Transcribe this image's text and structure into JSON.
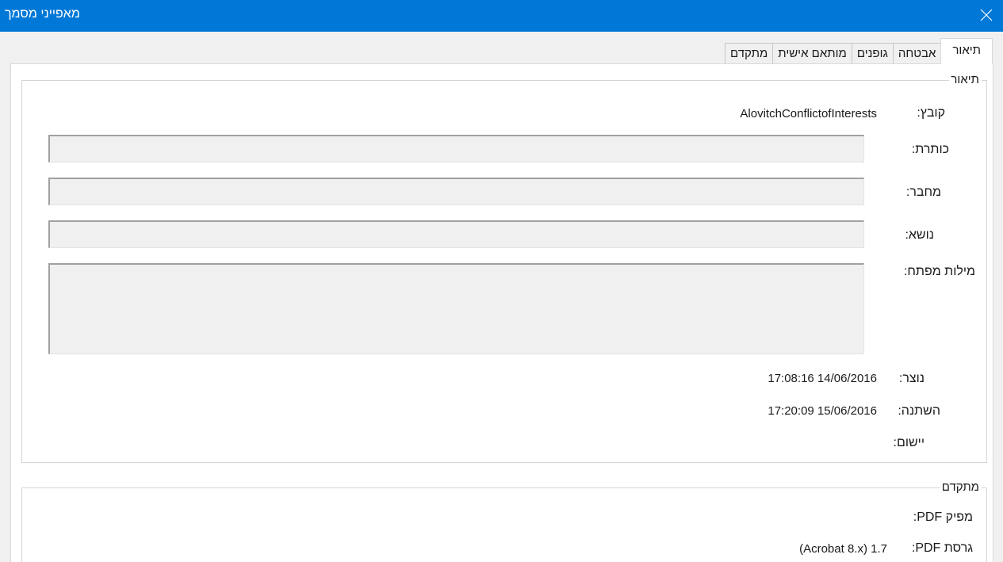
{
  "window": {
    "title": "מאפייני מסמך",
    "close_icon": "close-icon"
  },
  "tabs": [
    {
      "label": "תיאור",
      "active": true
    },
    {
      "label": "אבטחה",
      "active": false
    },
    {
      "label": "גופנים",
      "active": false
    },
    {
      "label": "מותאם אישית",
      "active": false
    },
    {
      "label": "מתקדם",
      "active": false
    }
  ],
  "description": {
    "legend": "תיאור",
    "file_label": "קובץ:",
    "file_value": "AlovitchConflictofInterests",
    "title_label": "כותרת:",
    "title_value": "",
    "author_label": "מחבר:",
    "author_value": "",
    "subject_label": "נושא:",
    "subject_value": "",
    "keywords_label": "מילות מפתח:",
    "keywords_value": "",
    "created_label": "נוצר:",
    "created_value": "17:08:16 14/06/2016",
    "modified_label": "השתנה:",
    "modified_value": "17:20:09 15/06/2016",
    "application_label": "יישום:",
    "application_value": ""
  },
  "advanced": {
    "legend": "מתקדם",
    "producer_label": "מפיק PDF:",
    "producer_value": "",
    "version_label": "גרסת PDF:",
    "version_value": "1.7 (Acrobat 8.x)"
  },
  "colors": {
    "titlebar": "#0078d7",
    "dialog_bg": "#f0f0f0",
    "field_bg": "#f0f0f0"
  }
}
